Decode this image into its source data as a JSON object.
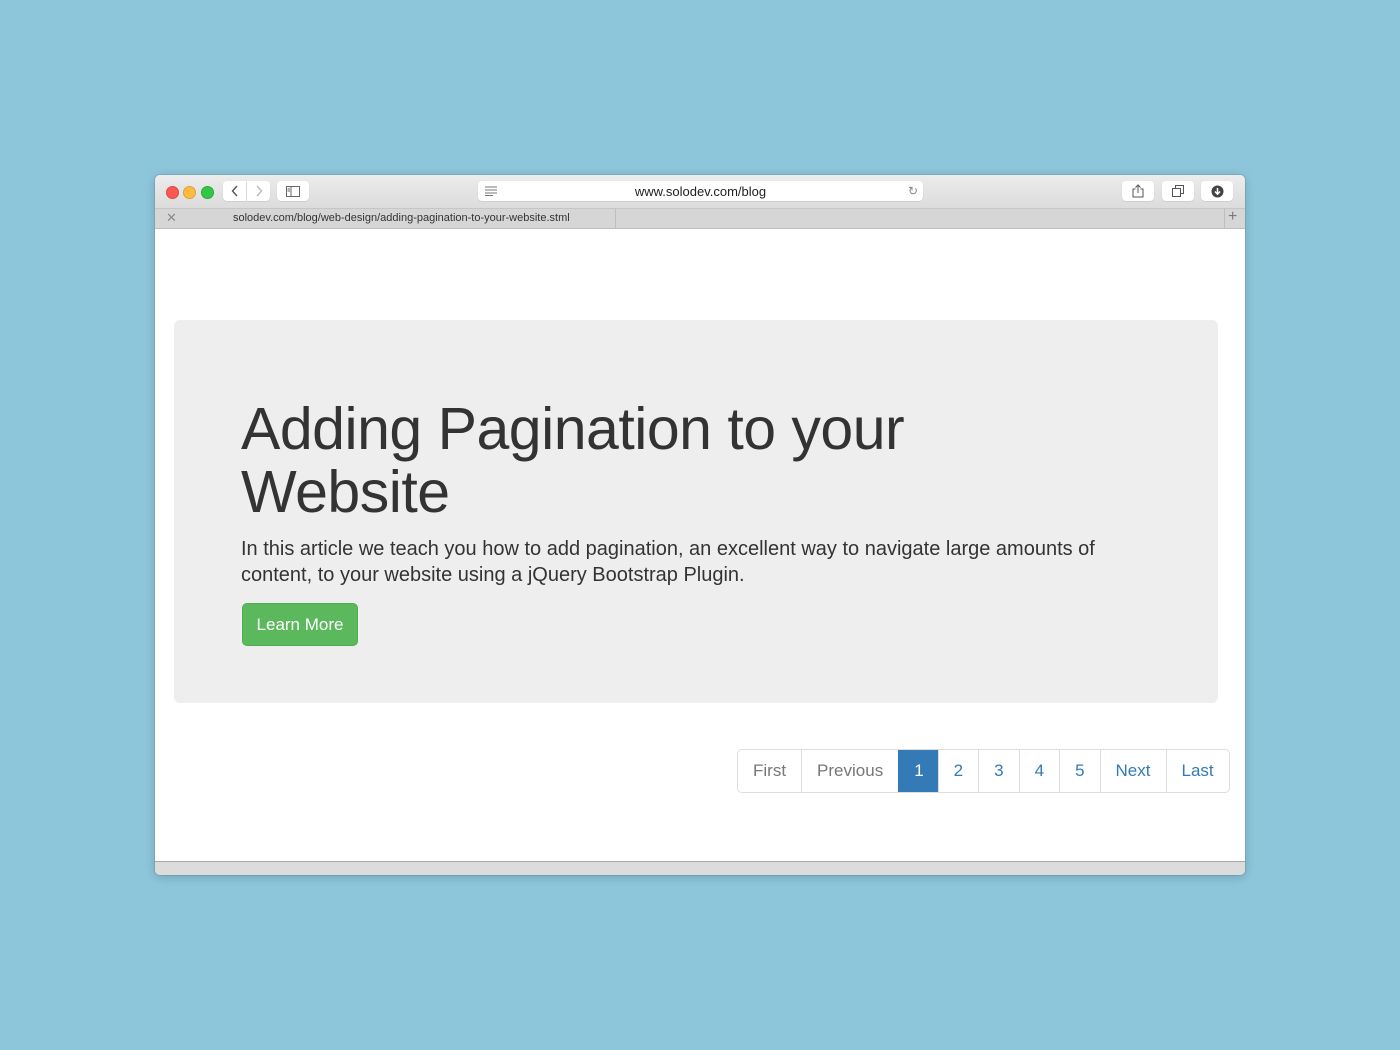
{
  "browser": {
    "address": "www.solodev.com/blog",
    "tab_title": "solodev.com/blog/web-design/adding-pagination-to-your-website.stml",
    "icons": {
      "close": "close-icon",
      "minimize": "minimize-icon",
      "maximize": "maximize-icon",
      "back": "chevron-left-icon",
      "forward": "chevron-right-icon",
      "sidebar": "sidebar-icon",
      "reader": "reader-icon",
      "reload": "reload-icon",
      "share": "share-icon",
      "tabs": "tabs-overview-icon",
      "download": "download-icon",
      "tab_close": "tab-close-icon",
      "new_tab": "plus-icon"
    }
  },
  "jumbotron": {
    "title": "Adding Pagination to your Website",
    "lead": "In this article we teach you how to add pagination, an excellent way to navigate large amounts of content, to your website using a jQuery Bootstrap Plugin.",
    "button_label": "Learn More",
    "button_color": "#5cb85c"
  },
  "pagination": {
    "first": "First",
    "previous": "Previous",
    "pages": [
      "1",
      "2",
      "3",
      "4",
      "5"
    ],
    "active_page": "1",
    "next": "Next",
    "last": "Last",
    "accent_color": "#337ab7"
  }
}
